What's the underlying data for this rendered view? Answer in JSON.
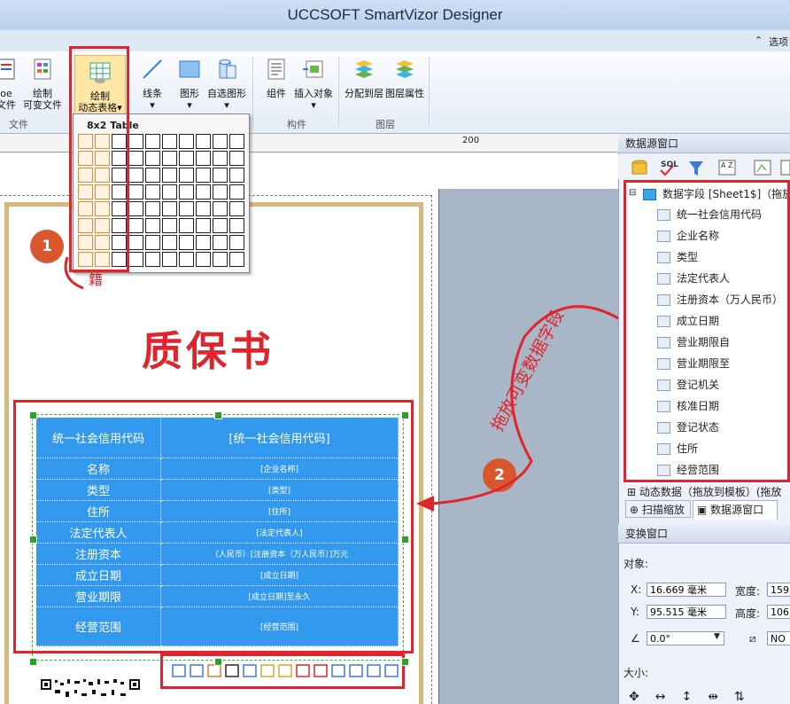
{
  "window": {
    "title": "UCCSOFT SmartVizor Designer",
    "options_label": "选项"
  },
  "ribbon": {
    "buttons": [
      {
        "label1": "oe",
        "label2": "文件",
        "name": "file-button"
      },
      {
        "label1": "绘制",
        "label2": "可变文件",
        "name": "draw-variable-file-button"
      },
      {
        "label1": "绘制",
        "label2": "动态表格",
        "name": "draw-dynamic-table-button"
      },
      {
        "label1": "线条",
        "label2": "",
        "name": "line-button"
      },
      {
        "label1": "图形",
        "label2": "",
        "name": "shape-button"
      },
      {
        "label1": "自选图形",
        "label2": "",
        "name": "custom-shape-button"
      },
      {
        "label1": "组件",
        "label2": "",
        "name": "component-button"
      },
      {
        "label1": "插入对象",
        "label2": "",
        "name": "insert-object-button"
      },
      {
        "label1": "分配到层",
        "label2": "",
        "name": "assign-layer-button"
      },
      {
        "label1": "图层属性",
        "label2": "",
        "name": "layer-properties-button"
      }
    ],
    "groups": {
      "file": "文件",
      "components": "构件",
      "layers": "图层"
    }
  },
  "table_picker": {
    "title": "8x2 Table"
  },
  "ruler": {
    "mark": "200"
  },
  "document": {
    "heading": "质保书",
    "partial_char": "籍",
    "table_rows": [
      {
        "label": "统一社会信用代码",
        "value": "[统一社会信用代码]"
      },
      {
        "label": "名称",
        "value": "[企业名称]"
      },
      {
        "label": "类型",
        "value": "[类型]"
      },
      {
        "label": "住所",
        "value": "[住所]"
      },
      {
        "label": "法定代表人",
        "value": "[法定代表人]"
      },
      {
        "label": "注册资本",
        "value": "（人民币）[注册资本（万人民币）]万元"
      },
      {
        "label": "成立日期",
        "value": "[成立日期]"
      },
      {
        "label": "营业期限",
        "value": "[成立日期]至永久"
      },
      {
        "label": "经营范围",
        "value": "[经营范围]"
      }
    ]
  },
  "annotations": {
    "badge1": "1",
    "badge2": "2",
    "drag_text": "拖放可变数据字段"
  },
  "datasource": {
    "title": "数据源窗口",
    "root": "数据字段 [Sheet1$]（拖放",
    "fields": [
      "统一社会信用代码",
      "企业名称",
      "类型",
      "法定代表人",
      "注册资本（万人民币）",
      "成立日期",
      "营业期限自",
      "营业期限至",
      "登记机关",
      "核准日期",
      "登记状态",
      "住所",
      "经营范围"
    ],
    "dynamic": "动态数据（拖放到模板）(拖放",
    "tabs": [
      "扫描缩放",
      "数据源窗口"
    ]
  },
  "transform": {
    "title": "变换窗口",
    "object_label": "对象:",
    "x_label": "X:",
    "x_value": "16.669 毫米",
    "y_label": "Y:",
    "y_value": "95.515 毫米",
    "width_label": "宽度:",
    "width_value": "159",
    "height_label": "高度:",
    "height_value": "106",
    "angle_value": "0.0°",
    "skew_value": "NO",
    "size_label": "大小:"
  },
  "colors": {
    "accent": "#e0242b",
    "table_blue": "#3399ee",
    "badge": "#d9572f"
  }
}
